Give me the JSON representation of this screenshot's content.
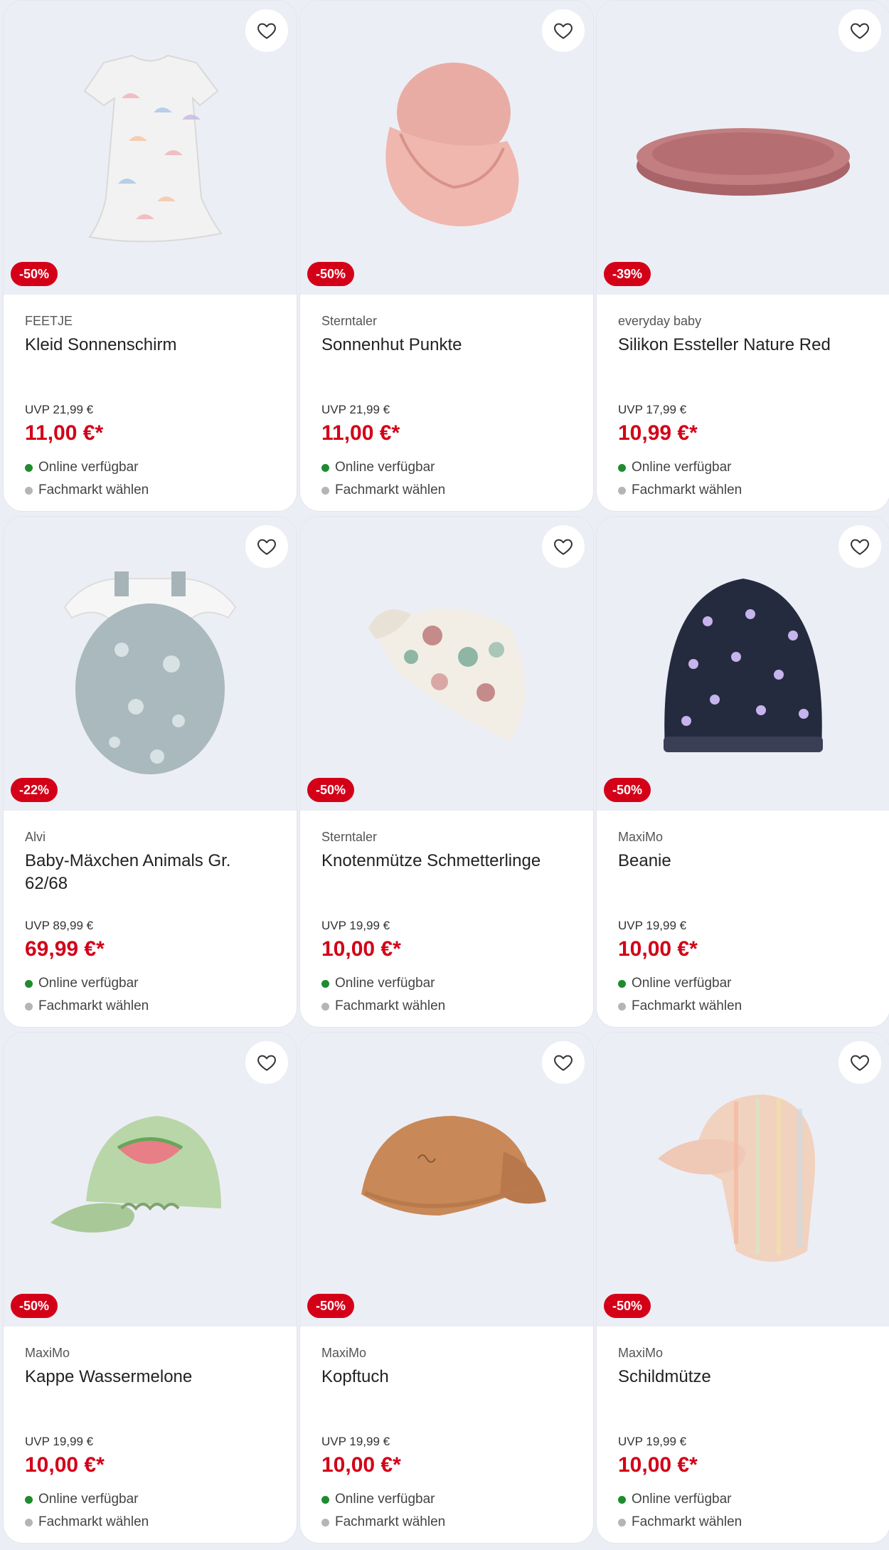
{
  "colors": {
    "sale_red": "#d30018",
    "available_green": "#1e8c2e",
    "store_grey": "#b5b5b5",
    "image_bg": "#eceef5"
  },
  "wishlist_icon": "heart-outline-icon",
  "products": [
    {
      "brand": "FEETJE",
      "title": "Kleid Sonnenschirm",
      "discount": "-50%",
      "uvp": "UVP 21,99 €",
      "price": "11,00 €*",
      "online": "Online verfügbar",
      "store": "Fachmarkt wählen",
      "art": "dress"
    },
    {
      "brand": "Sterntaler",
      "title": "Sonnenhut Punkte",
      "discount": "-50%",
      "uvp": "UVP 21,99 €",
      "price": "11,00 €*",
      "online": "Online verfügbar",
      "store": "Fachmarkt wählen",
      "art": "sunhat"
    },
    {
      "brand": "everyday baby",
      "title": "Silikon Essteller Nature Red",
      "discount": "-39%",
      "uvp": "UVP 17,99 €",
      "price": "10,99 €*",
      "online": "Online verfügbar",
      "store": "Fachmarkt wählen",
      "art": "plate"
    },
    {
      "brand": "Alvi",
      "title": "Baby-Mäxchen Animals Gr. 62/68",
      "discount": "-22%",
      "uvp": "UVP 89,99 €",
      "price": "69,99 €*",
      "online": "Online verfügbar",
      "store": "Fachmarkt wählen",
      "art": "sleepingbag"
    },
    {
      "brand": "Sterntaler",
      "title": "Knotenmütze Schmetterlinge",
      "discount": "-50%",
      "uvp": "UVP 19,99 €",
      "price": "10,00 €*",
      "online": "Online verfügbar",
      "store": "Fachmarkt wählen",
      "art": "knothat"
    },
    {
      "brand": "MaxiMo",
      "title": "Beanie",
      "discount": "-50%",
      "uvp": "UVP 19,99 €",
      "price": "10,00 €*",
      "online": "Online verfügbar",
      "store": "Fachmarkt wählen",
      "art": "beanie"
    },
    {
      "brand": "MaxiMo",
      "title": "Kappe Wassermelone",
      "discount": "-50%",
      "uvp": "UVP 19,99 €",
      "price": "10,00 €*",
      "online": "Online verfügbar",
      "store": "Fachmarkt wählen",
      "art": "cap"
    },
    {
      "brand": "MaxiMo",
      "title": "Kopftuch",
      "discount": "-50%",
      "uvp": "UVP 19,99 €",
      "price": "10,00 €*",
      "online": "Online verfügbar",
      "store": "Fachmarkt wählen",
      "art": "headscarf"
    },
    {
      "brand": "MaxiMo",
      "title": "Schildmütze",
      "discount": "-50%",
      "uvp": "UVP 19,99 €",
      "price": "10,00 €*",
      "online": "Online verfügbar",
      "store": "Fachmarkt wählen",
      "art": "fluphat"
    }
  ]
}
